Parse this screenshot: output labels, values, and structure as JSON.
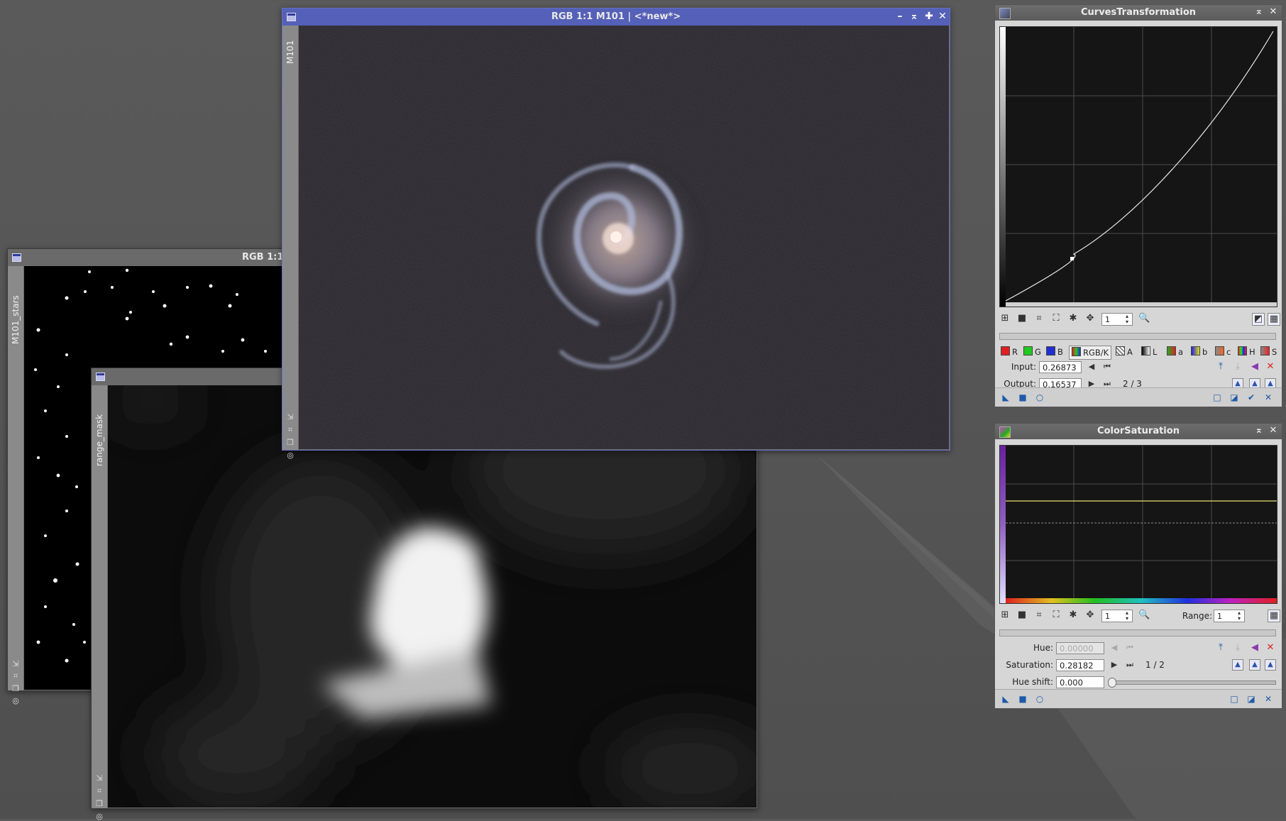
{
  "windows": {
    "main": {
      "title": "RGB 1:1 M101 | <*new*>",
      "side_label": "M101"
    },
    "stars": {
      "title": "RGB 1:1",
      "side_label": "M101_stars"
    },
    "mask": {
      "side_label": "range_mask"
    }
  },
  "curves": {
    "title": "CurvesTransformation",
    "zoom_value": "1",
    "channels": [
      "R",
      "G",
      "B",
      "RGB/K",
      "A",
      "L",
      "a",
      "b",
      "c",
      "H",
      "S"
    ],
    "selected_channel": "RGB/K",
    "input_label": "Input:",
    "input_value": "0.26873",
    "output_label": "Output:",
    "output_value": "0.16537",
    "point_counter": "2 / 3"
  },
  "saturation": {
    "title": "ColorSaturation",
    "zoom_value": "1",
    "range_label": "Range:",
    "range_value": "1",
    "hue_label": "Hue:",
    "hue_value": "0.00000",
    "saturation_label": "Saturation:",
    "saturation_value": "0.28182",
    "hueshift_label": "Hue shift:",
    "hueshift_value": "0.000",
    "point_counter": "1 / 2"
  },
  "colors": {
    "active_titlebar": "#5560b8",
    "panel_bg": "#d6d6d6",
    "graph_bg": "#151515"
  },
  "icons": [
    "window-icon",
    "minimize-icon",
    "shade-icon",
    "maximize-icon",
    "close-icon",
    "zoom-icon",
    "grid-icon",
    "new-instance-icon",
    "apply-global-icon",
    "preview-icon",
    "reset-icon",
    "apply-icon"
  ]
}
